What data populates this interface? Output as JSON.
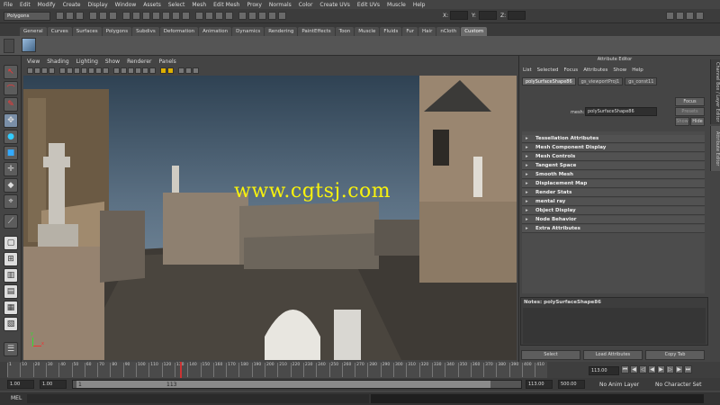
{
  "menubar": {
    "items": [
      "File",
      "Edit",
      "Modify",
      "Create",
      "Display",
      "Window",
      "Assets",
      "Select",
      "Mesh",
      "Edit Mesh",
      "Proxy",
      "Normals",
      "Color",
      "Create UVs",
      "Edit UVs",
      "Muscle",
      "Help"
    ]
  },
  "statusline": {
    "mode": "Polygons",
    "coord_x": "X:",
    "coord_y": "Y:",
    "coord_z": "Z:"
  },
  "shelf": {
    "tabs": [
      "General",
      "Curves",
      "Surfaces",
      "Polygons",
      "Subdivs",
      "Deformation",
      "Animation",
      "Dynamics",
      "Rendering",
      "PaintEffects",
      "Toon",
      "Muscle",
      "Fluids",
      "Fur",
      "Hair",
      "nCloth",
      "Custom"
    ],
    "active": "Custom"
  },
  "viewport": {
    "menu": [
      "View",
      "Shading",
      "Lighting",
      "Show",
      "Renderer",
      "Panels"
    ],
    "axis_x": "x",
    "axis_y": "y"
  },
  "watermark": "www.cgtsj.com",
  "attribute_editor": {
    "title": "Attribute Editor",
    "menu": [
      "List",
      "Selected",
      "Focus",
      "Attributes",
      "Show",
      "Help"
    ],
    "tabs": [
      "polySurfaceShape86",
      "gs_viewportProj1",
      "gs_const11"
    ],
    "mesh_label": "mesh:",
    "mesh_value": "polySurfaceShape86",
    "focus": "Focus",
    "presets": "Presets",
    "show": "Show",
    "hide": "Hide",
    "sections": [
      "Tessellation Attributes",
      "Mesh Component Display",
      "Mesh Controls",
      "Tangent Space",
      "Smooth Mesh",
      "Displacement Map",
      "Render Stats",
      "mental ray",
      "Object Display",
      "Node Behavior",
      "Extra Attributes"
    ],
    "notes": "Notes: polySurfaceShape86",
    "buttons": {
      "select": "Select",
      "load": "Load Attributes",
      "copy": "Copy Tab"
    }
  },
  "side_tabs": {
    "channel_box": "Channel Box / Layer Editor",
    "ae": "Attribute Editor"
  },
  "timeline": {
    "ticks": [
      "1",
      "10",
      "20",
      "30",
      "40",
      "50",
      "60",
      "70",
      "80",
      "90",
      "100",
      "110",
      "120",
      "130",
      "140",
      "150",
      "160",
      "170",
      "180",
      "190",
      "200",
      "210",
      "220",
      "230",
      "240",
      "250",
      "260",
      "270",
      "280",
      "290",
      "300",
      "310",
      "320",
      "330",
      "340",
      "350",
      "360",
      "370",
      "380",
      "390",
      "400",
      "410"
    ],
    "current": "113.00"
  },
  "range": {
    "start": "1.00",
    "start2": "1.00",
    "marker": "1",
    "end_marker": "113",
    "end": "113.00",
    "end2": "500.00",
    "anim_layer": "No Anim Layer",
    "char_set": "No Character Set"
  },
  "mel": {
    "label": "MEL"
  }
}
